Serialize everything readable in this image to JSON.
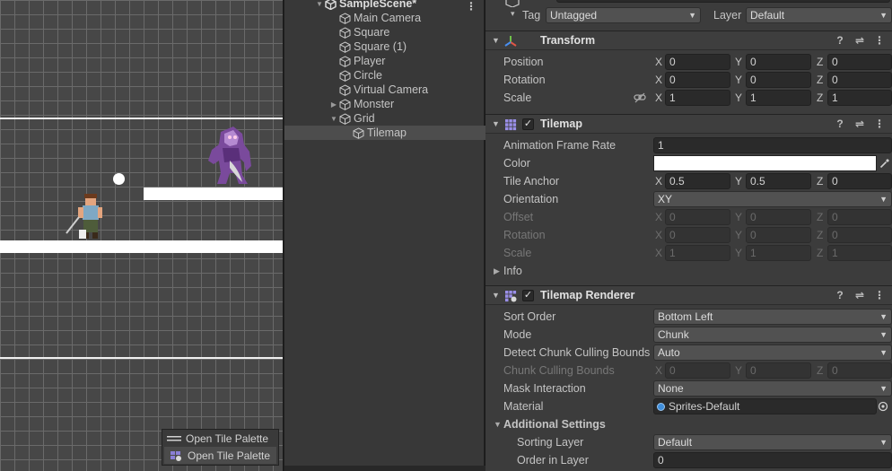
{
  "hierarchy": {
    "scene_name": "SampleScene*",
    "items": [
      {
        "label": "Main Camera"
      },
      {
        "label": "Square"
      },
      {
        "label": "Square (1)"
      },
      {
        "label": "Player"
      },
      {
        "label": "Circle"
      },
      {
        "label": "Virtual Camera"
      },
      {
        "label": "Monster"
      },
      {
        "label": "Grid"
      },
      {
        "label": "Tilemap"
      }
    ]
  },
  "scene": {
    "overlay": {
      "item1": "Open Tile Palette",
      "item2": "Open Tile Palette"
    }
  },
  "inspector": {
    "tag_label": "Tag",
    "tag_value": "Untagged",
    "layer_label": "Layer",
    "layer_value": "Default",
    "transform": {
      "title": "Transform",
      "position_label": "Position",
      "rotation_label": "Rotation",
      "scale_label": "Scale",
      "position": {
        "x": "0",
        "y": "0",
        "z": "0"
      },
      "rotation": {
        "x": "0",
        "y": "0",
        "z": "0"
      },
      "scale": {
        "x": "1",
        "y": "1",
        "z": "1"
      }
    },
    "tilemap": {
      "title": "Tilemap",
      "anim_rate_label": "Animation Frame Rate",
      "anim_rate": "1",
      "color_label": "Color",
      "color_value": "#ffffff",
      "tile_anchor_label": "Tile Anchor",
      "tile_anchor": {
        "x": "0.5",
        "y": "0.5",
        "z": "0"
      },
      "orientation_label": "Orientation",
      "orientation": "XY",
      "offset_label": "Offset",
      "offset": {
        "x": "0",
        "y": "0",
        "z": "0"
      },
      "rotation_label": "Rotation",
      "rotation": {
        "x": "0",
        "y": "0",
        "z": "0"
      },
      "scale_label": "Scale",
      "scale": {
        "x": "1",
        "y": "1",
        "z": "1"
      },
      "info_label": "Info"
    },
    "renderer": {
      "title": "Tilemap Renderer",
      "sort_order_label": "Sort Order",
      "sort_order": "Bottom Left",
      "mode_label": "Mode",
      "mode": "Chunk",
      "detect_label": "Detect Chunk Culling Bounds",
      "detect": "Auto",
      "bounds_label": "Chunk Culling Bounds",
      "bounds": {
        "x": "0",
        "y": "0",
        "z": "0"
      },
      "mask_label": "Mask Interaction",
      "mask": "None",
      "material_label": "Material",
      "material": "Sprites-Default",
      "additional_label": "Additional Settings",
      "sorting_layer_label": "Sorting Layer",
      "sorting_layer": "Default",
      "order_label": "Order in Layer",
      "order": "0"
    }
  },
  "axes": {
    "x": "X",
    "y": "Y",
    "z": "Z"
  },
  "colors": {
    "accent_blue": "#3f8edb",
    "panel": "#3c3c3c",
    "field": "#2a2a2a"
  }
}
